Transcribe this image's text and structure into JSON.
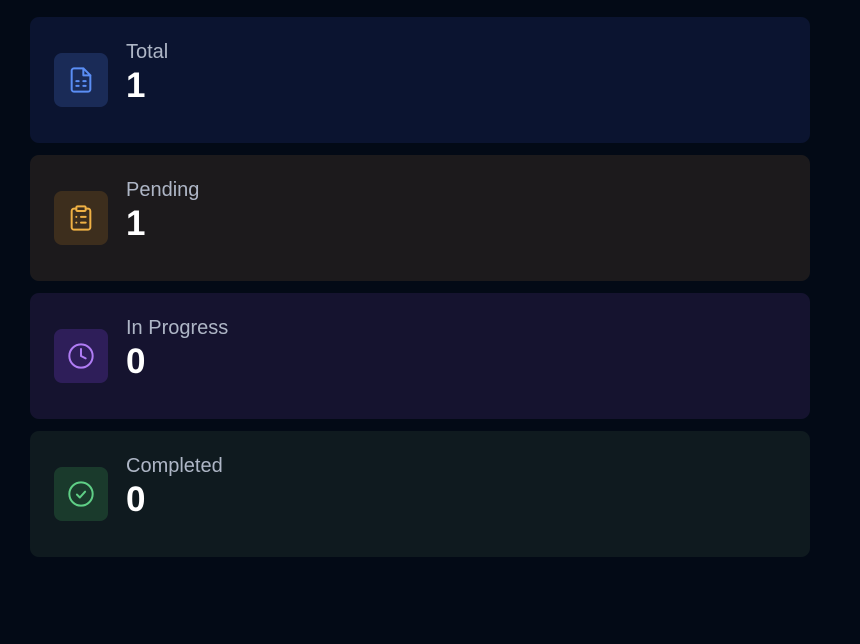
{
  "stats": [
    {
      "label": "Total",
      "value": "1",
      "icon": "file-text-icon",
      "accent": "#5b8ef5"
    },
    {
      "label": "Pending",
      "value": "1",
      "icon": "clipboard-list-icon",
      "accent": "#f0b144"
    },
    {
      "label": "In Progress",
      "value": "0",
      "icon": "clock-icon",
      "accent": "#b07cf5"
    },
    {
      "label": "Completed",
      "value": "0",
      "icon": "check-circle-icon",
      "accent": "#5fcf86"
    }
  ]
}
